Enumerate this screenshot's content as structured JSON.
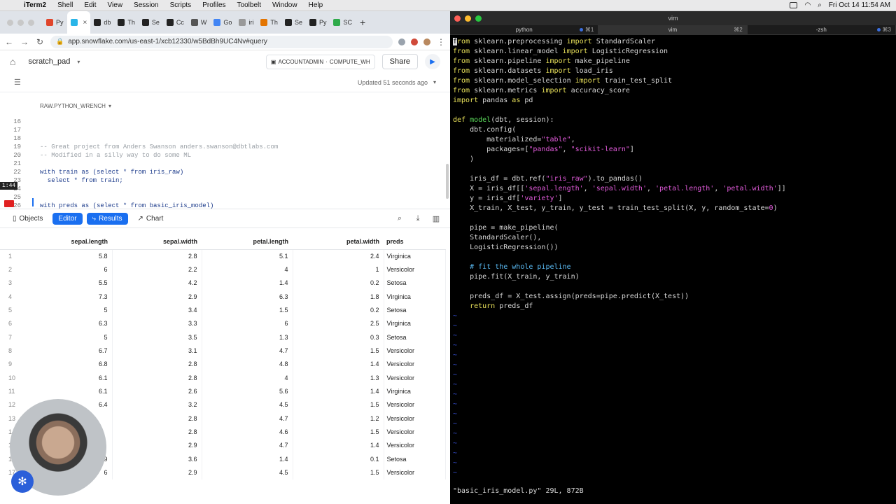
{
  "menubar": {
    "app": "iTerm2",
    "items": [
      "Shell",
      "Edit",
      "View",
      "Session",
      "Scripts",
      "Profiles",
      "Toolbelt",
      "Window",
      "Help"
    ],
    "clock": "Fri Oct 14  11:54 AM"
  },
  "browser": {
    "tabs": [
      {
        "label": "Py",
        "color": "#e0452b"
      },
      {
        "label": "",
        "color": "#29b5e8",
        "active": true
      },
      {
        "label": "db",
        "color": "#222222"
      },
      {
        "label": "Th",
        "color": "#222222"
      },
      {
        "label": "Se",
        "color": "#222222"
      },
      {
        "label": "Cc",
        "color": "#222222"
      },
      {
        "label": "W",
        "color": "#555555"
      },
      {
        "label": "Go",
        "color": "#4285f4"
      },
      {
        "label": "iri",
        "color": "#999999"
      },
      {
        "label": "Th",
        "color": "#e37400"
      },
      {
        "label": "Se",
        "color": "#222222"
      },
      {
        "label": "Py",
        "color": "#222222"
      },
      {
        "label": "SC",
        "color": "#2eaa4a"
      }
    ],
    "url": "app.snowflake.com/us-east-1/xcb12330/w5BdBh9UC4Nv#query"
  },
  "snowflake": {
    "worksheet": "scratch_pad",
    "role": "ACCOUNTADMIN",
    "warehouse": "COMPUTE_WH",
    "share_label": "Share",
    "updated": "Updated 51 seconds ago",
    "context": "RAW.PYTHON_WRENCH",
    "time_badge": "1:44",
    "editor_lines": [
      {
        "num": "16",
        "text": "",
        "comment": false
      },
      {
        "num": "17",
        "text": "",
        "comment": false
      },
      {
        "num": "18",
        "text": "",
        "comment": false
      },
      {
        "num": "19",
        "text": "-- Great project from Anders Swanson anders.swanson@dbtlabs.com",
        "comment": true
      },
      {
        "num": "20",
        "text": "-- Modified in a silly way to do some ML",
        "comment": true
      },
      {
        "num": "21",
        "text": "",
        "comment": false
      },
      {
        "num": "22",
        "text": "with train as (select * from iris_raw)",
        "comment": false
      },
      {
        "num": "23",
        "text": "  select * from train;",
        "comment": false
      },
      {
        "num": "24",
        "text": "",
        "comment": false
      },
      {
        "num": "25",
        "text": "",
        "comment": false
      },
      {
        "num": "26",
        "text": "with preds as (select * from basic_iris_model)",
        "comment": false
      }
    ],
    "toolbar": {
      "objects": "Objects",
      "editor": "Editor",
      "results": "Results",
      "chart": "Chart"
    },
    "columns": [
      "sepal.length",
      "sepal.width",
      "petal.length",
      "petal.width",
      "preds"
    ],
    "rows": [
      [
        "1",
        "5.8",
        "2.8",
        "5.1",
        "2.4",
        "Virginica"
      ],
      [
        "2",
        "6",
        "2.2",
        "4",
        "1",
        "Versicolor"
      ],
      [
        "3",
        "5.5",
        "4.2",
        "1.4",
        "0.2",
        "Setosa"
      ],
      [
        "4",
        "7.3",
        "2.9",
        "6.3",
        "1.8",
        "Virginica"
      ],
      [
        "5",
        "5",
        "3.4",
        "1.5",
        "0.2",
        "Setosa"
      ],
      [
        "6",
        "6.3",
        "3.3",
        "6",
        "2.5",
        "Virginica"
      ],
      [
        "7",
        "5",
        "3.5",
        "1.3",
        "0.3",
        "Setosa"
      ],
      [
        "8",
        "6.7",
        "3.1",
        "4.7",
        "1.5",
        "Versicolor"
      ],
      [
        "9",
        "6.8",
        "2.8",
        "4.8",
        "1.4",
        "Versicolor"
      ],
      [
        "10",
        "6.1",
        "2.8",
        "4",
        "1.3",
        "Versicolor"
      ],
      [
        "11",
        "6.1",
        "2.6",
        "5.6",
        "1.4",
        "Virginica"
      ],
      [
        "12",
        "6.4",
        "3.2",
        "4.5",
        "1.5",
        "Versicolor"
      ],
      [
        "13",
        "",
        "2.8",
        "4.7",
        "1.2",
        "Versicolor"
      ],
      [
        "14",
        "",
        "2.8",
        "4.6",
        "1.5",
        "Versicolor"
      ],
      [
        "15",
        "",
        "2.9",
        "4.7",
        "1.4",
        "Versicolor"
      ],
      [
        "16",
        "4.9",
        "3.6",
        "1.4",
        "0.1",
        "Setosa"
      ],
      [
        "17",
        "6",
        "2.9",
        "4.5",
        "1.5",
        "Versicolor"
      ]
    ]
  },
  "terminal": {
    "title": "vim",
    "tabs": [
      {
        "label": "python",
        "shortcut": "⌘1",
        "dot": true
      },
      {
        "label": "vim",
        "shortcut": "⌘2",
        "dot": false,
        "active": true
      },
      {
        "label": "-zsh",
        "shortcut": "⌘3",
        "dot": true
      }
    ],
    "lines": [
      [
        [
          "kw",
          "f"
        ],
        [
          "kw",
          "rom"
        ],
        [
          "pl",
          " sklearn.preprocessing "
        ],
        [
          "kw",
          "import"
        ],
        [
          "pl",
          " StandardScaler"
        ]
      ],
      [
        [
          "kw",
          "from"
        ],
        [
          "pl",
          " sklearn.linear_model "
        ],
        [
          "kw",
          "import"
        ],
        [
          "pl",
          " LogisticRegression"
        ]
      ],
      [
        [
          "kw",
          "from"
        ],
        [
          "pl",
          " sklearn.pipeline "
        ],
        [
          "kw",
          "import"
        ],
        [
          "pl",
          " make_pipeline"
        ]
      ],
      [
        [
          "kw",
          "from"
        ],
        [
          "pl",
          " sklearn.datasets "
        ],
        [
          "kw",
          "import"
        ],
        [
          "pl",
          " load_iris"
        ]
      ],
      [
        [
          "kw",
          "from"
        ],
        [
          "pl",
          " sklearn.model_selection "
        ],
        [
          "kw",
          "import"
        ],
        [
          "pl",
          " train_test_split"
        ]
      ],
      [
        [
          "kw",
          "from"
        ],
        [
          "pl",
          " sklearn.metrics "
        ],
        [
          "kw",
          "import"
        ],
        [
          "pl",
          " accuracy_score"
        ]
      ],
      [
        [
          "kw",
          "import"
        ],
        [
          "pl",
          " pandas "
        ],
        [
          "kw",
          "as"
        ],
        [
          "pl",
          " pd"
        ]
      ],
      [],
      [
        [
          "kw",
          "def"
        ],
        [
          "pl",
          " "
        ],
        [
          "nm",
          "model"
        ],
        [
          "pl",
          "(dbt, session):"
        ]
      ],
      [
        [
          "pl",
          "    dbt.config("
        ]
      ],
      [
        [
          "pl",
          "        materialized="
        ],
        [
          "st",
          "\"table\""
        ],
        [
          "pl",
          ","
        ]
      ],
      [
        [
          "pl",
          "        packages=["
        ],
        [
          "st",
          "\"pandas\""
        ],
        [
          "pl",
          ", "
        ],
        [
          "st",
          "\"scikit-learn\""
        ],
        [
          "pl",
          "]"
        ]
      ],
      [
        [
          "pl",
          "    )"
        ]
      ],
      [],
      [
        [
          "pl",
          "    iris_df = dbt.ref("
        ],
        [
          "st",
          "\"iris_raw\""
        ],
        [
          "pl",
          ").to_pandas()"
        ]
      ],
      [
        [
          "pl",
          "    X = iris_df[["
        ],
        [
          "st",
          "'sepal.length'"
        ],
        [
          "pl",
          ", "
        ],
        [
          "st",
          "'sepal.width'"
        ],
        [
          "pl",
          ", "
        ],
        [
          "st",
          "'petal.length'"
        ],
        [
          "pl",
          ", "
        ],
        [
          "st",
          "'petal.width'"
        ],
        [
          "pl",
          "]]"
        ]
      ],
      [
        [
          "pl",
          "    y = iris_df["
        ],
        [
          "st",
          "'variety'"
        ],
        [
          "pl",
          "]"
        ]
      ],
      [
        [
          "pl",
          "    X_train, X_test, y_train, y_test = train_test_split(X, y, random_state="
        ],
        [
          "st",
          "0"
        ],
        [
          "pl",
          ")"
        ]
      ],
      [],
      [
        [
          "pl",
          "    pipe = make_pipeline("
        ]
      ],
      [
        [
          "pl",
          "    StandardScaler(),"
        ]
      ],
      [
        [
          "pl",
          "    LogisticRegression())"
        ]
      ],
      [],
      [
        [
          "cmt",
          "    # fit the whole pipeline"
        ]
      ],
      [
        [
          "pl",
          "    pipe.fit(X_train, y_train)"
        ]
      ],
      [],
      [
        [
          "pl",
          "    preds_df = X_test.assign(preds=pipe.predict(X_test))"
        ]
      ],
      [
        [
          "kw",
          "    return"
        ],
        [
          "pl",
          " preds_df"
        ]
      ]
    ],
    "status": "\"basic_iris_model.py\" 29L, 872B"
  }
}
